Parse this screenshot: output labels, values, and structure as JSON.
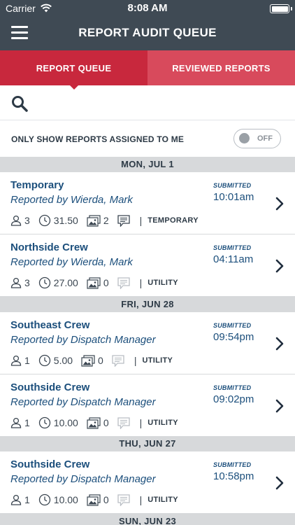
{
  "status": {
    "carrier": "Carrier",
    "time": "8:08 AM"
  },
  "nav": {
    "title": "REPORT AUDIT QUEUE"
  },
  "tabs": [
    {
      "label": "REPORT QUEUE",
      "active": true
    },
    {
      "label": "REVIEWED REPORTS",
      "active": false
    }
  ],
  "filter": {
    "label": "ONLY SHOW REPORTS ASSIGNED TO ME",
    "toggle_state": "OFF"
  },
  "colors": {
    "header": "#3f4a54",
    "accent": "#c8283d",
    "accent_light": "#d84a5c",
    "text_blue": "#1c4f7c"
  },
  "groups": [
    {
      "date": "MON, JUL 1",
      "reports": [
        {
          "crew": "Temporary",
          "reporter": "Reported by Wierda, Mark",
          "people": "3",
          "hours": "31.50",
          "photos": "2",
          "has_comments": true,
          "type": "TEMPORARY",
          "submitted_label": "SUBMITTED",
          "submitted_time": "10:01am"
        },
        {
          "crew": "Northside Crew",
          "reporter": "Reported by Wierda, Mark",
          "people": "3",
          "hours": "27.00",
          "photos": "0",
          "has_comments": false,
          "type": "UTILITY",
          "submitted_label": "SUBMITTED",
          "submitted_time": "04:11am"
        }
      ]
    },
    {
      "date": "FRI, JUN 28",
      "reports": [
        {
          "crew": "Southeast Crew",
          "reporter": "Reported by Dispatch Manager",
          "people": "1",
          "hours": "5.00",
          "photos": "0",
          "has_comments": false,
          "type": "UTILITY",
          "submitted_label": "SUBMITTED",
          "submitted_time": "09:54pm"
        },
        {
          "crew": "Southside Crew",
          "reporter": "Reported by Dispatch Manager",
          "people": "1",
          "hours": "10.00",
          "photos": "0",
          "has_comments": false,
          "type": "UTILITY",
          "submitted_label": "SUBMITTED",
          "submitted_time": "09:02pm"
        }
      ]
    },
    {
      "date": "THU, JUN 27",
      "reports": [
        {
          "crew": "Southside Crew",
          "reporter": "Reported by Dispatch Manager",
          "people": "1",
          "hours": "10.00",
          "photos": "0",
          "has_comments": false,
          "type": "UTILITY",
          "submitted_label": "SUBMITTED",
          "submitted_time": "10:58pm"
        }
      ]
    },
    {
      "date": "SUN, JUN 23",
      "reports": []
    }
  ]
}
